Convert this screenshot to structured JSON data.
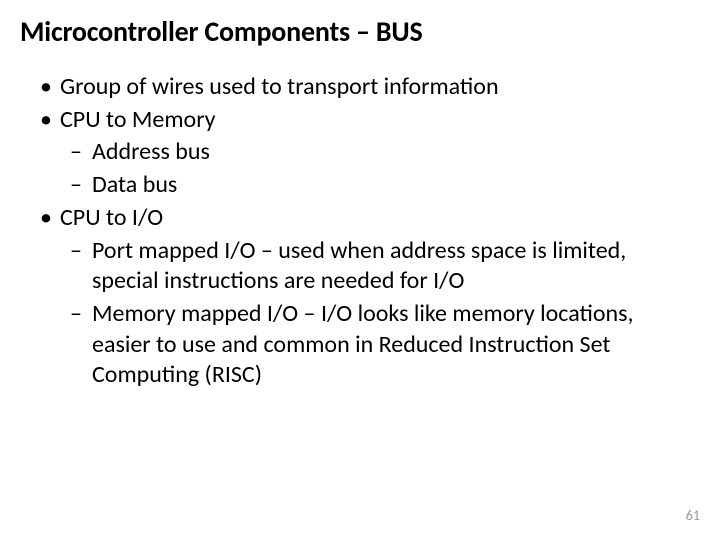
{
  "title": "Microcontroller Components – BUS",
  "bullets": {
    "b0": "Group of wires used to transport information",
    "b1": "CPU to Memory",
    "b1a": "Address bus",
    "b1b": "Data bus",
    "b2": "CPU to I/O",
    "b2a": "Port mapped I/O – used when address space is limited, special instructions are needed for I/O",
    "b2b": "Memory mapped I/O – I/O looks like memory locations, easier to use and common in Reduced Instruction Set Computing (RISC)"
  },
  "page_number": "61"
}
